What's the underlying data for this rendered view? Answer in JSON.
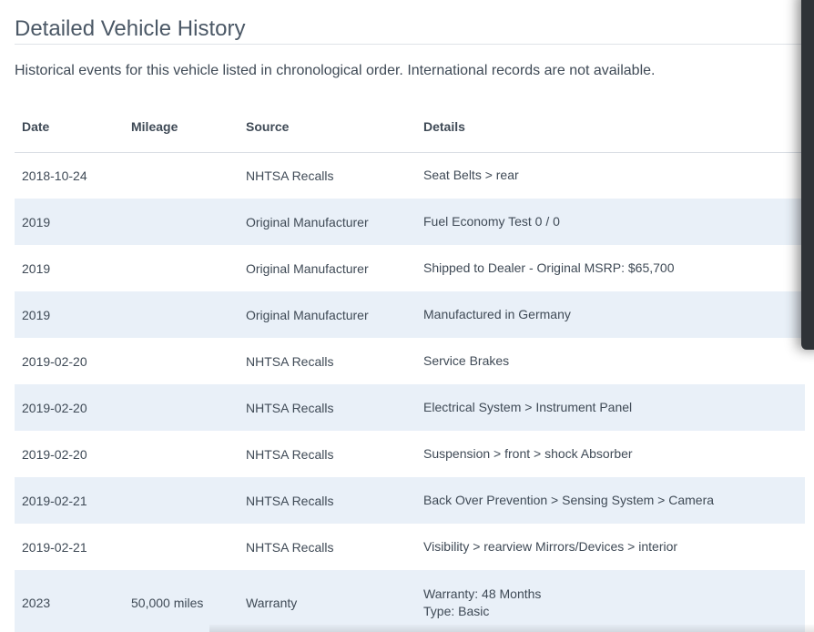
{
  "page": {
    "title": "Detailed Vehicle History",
    "intro": "Historical events for this vehicle listed in chronological order. International records are not available."
  },
  "table": {
    "headers": {
      "date": "Date",
      "mileage": "Mileage",
      "source": "Source",
      "details": "Details"
    },
    "rows": [
      {
        "date": "2018-10-24",
        "mileage": "",
        "source": "NHTSA Recalls",
        "details": [
          "Seat Belts > rear"
        ]
      },
      {
        "date": "2019",
        "mileage": "",
        "source": "Original Manufacturer",
        "details": [
          "Fuel Economy Test 0 / 0"
        ]
      },
      {
        "date": "2019",
        "mileage": "",
        "source": "Original Manufacturer",
        "details": [
          "Shipped to Dealer - Original MSRP: $65,700"
        ]
      },
      {
        "date": "2019",
        "mileage": "",
        "source": "Original Manufacturer",
        "details": [
          "Manufactured in Germany"
        ]
      },
      {
        "date": "2019-02-20",
        "mileage": "",
        "source": "NHTSA Recalls",
        "details": [
          "Service Brakes"
        ]
      },
      {
        "date": "2019-02-20",
        "mileage": "",
        "source": "NHTSA Recalls",
        "details": [
          "Electrical System > Instrument Panel"
        ]
      },
      {
        "date": "2019-02-20",
        "mileage": "",
        "source": "NHTSA Recalls",
        "details": [
          "Suspension > front > shock Absorber"
        ]
      },
      {
        "date": "2019-02-21",
        "mileage": "",
        "source": "NHTSA Recalls",
        "details": [
          "Back Over Prevention > Sensing System > Camera"
        ]
      },
      {
        "date": "2019-02-21",
        "mileage": "",
        "source": "NHTSA Recalls",
        "details": [
          "Visibility > rearview Mirrors/Devices > interior"
        ]
      },
      {
        "date": "2023",
        "mileage": "50,000 miles",
        "source": "Warranty",
        "details": [
          "Warranty: 48 Months",
          "Type: Basic"
        ]
      }
    ]
  },
  "colors": {
    "stripe": "#e9f0f8",
    "title": "#4b5866",
    "text": "#3f4a56",
    "overlay": "#2f3337"
  }
}
